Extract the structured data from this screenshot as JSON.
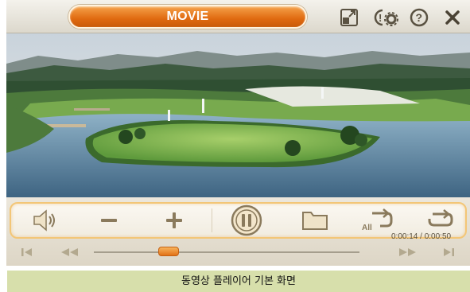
{
  "header": {
    "title": "MOVIE",
    "icons": [
      "resize-icon",
      "settings-icon",
      "help-icon",
      "close-icon"
    ]
  },
  "player": {
    "time_display": "0:00:14 / 0:00:50",
    "progress_fraction": 0.28,
    "controls": [
      "volume-icon",
      "volume-down-icon",
      "volume-up-icon",
      "pause-icon",
      "folder-icon",
      "repeat-all-icon",
      "repeat-icon"
    ],
    "transport": [
      "skip-previous-icon",
      "rewind-icon",
      "fast-forward-icon",
      "skip-next-icon"
    ]
  },
  "caption": "동영상 플레이어 기본 화면",
  "colors": {
    "accent": "#e6781a",
    "caption_bg": "#d7dfab",
    "icon": "#8a7a5c"
  }
}
